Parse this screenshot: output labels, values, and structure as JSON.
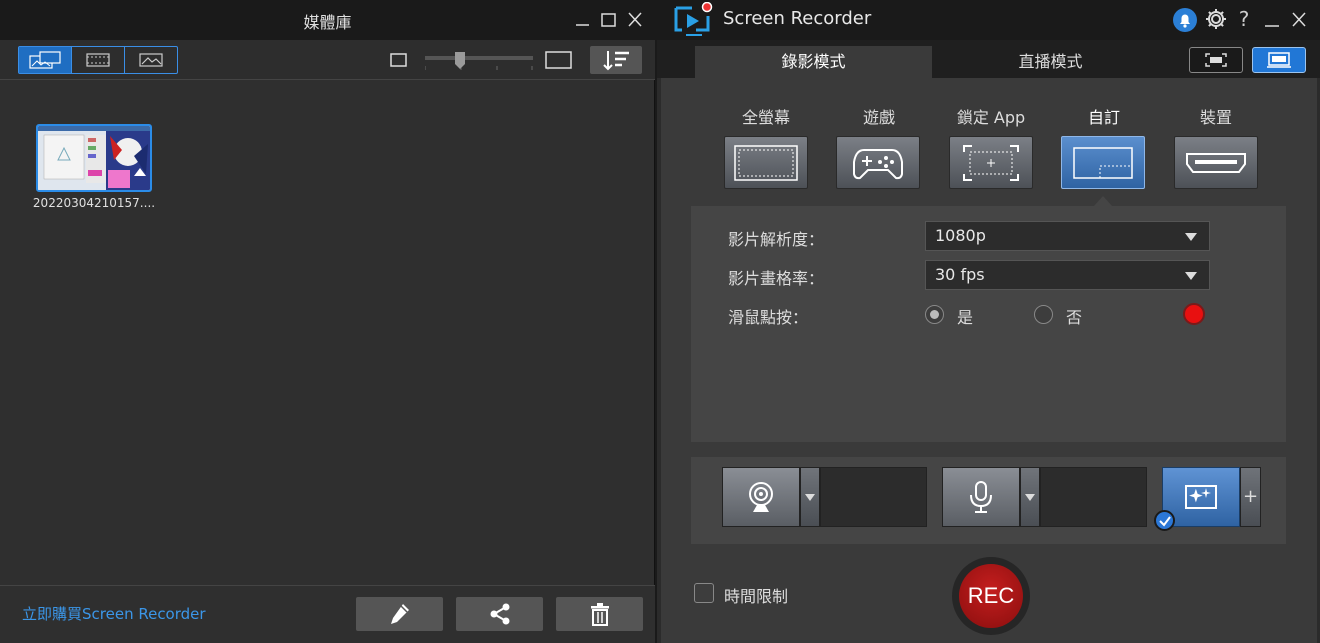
{
  "media_library": {
    "title": "媒體庫",
    "thumbnail_label": "20220304210157....",
    "buy_link": "立即購買Screen Recorder"
  },
  "recorder": {
    "title": "Screen Recorder",
    "tabs": [
      "錄影模式",
      "直播模式"
    ],
    "modes": [
      {
        "label": "全螢幕",
        "icon": "fullscreen-icon"
      },
      {
        "label": "遊戲",
        "icon": "gamepad-icon"
      },
      {
        "label": "鎖定 App",
        "icon": "lock-app-icon"
      },
      {
        "label": "自訂",
        "icon": "custom-region-icon",
        "selected": true
      },
      {
        "label": "裝置",
        "icon": "hdmi-icon"
      }
    ],
    "settings": {
      "resolution_label": "影片解析度：",
      "resolution_value": "1080p",
      "framerate_label": "影片畫格率：",
      "framerate_value": "30 fps",
      "mouse_label": "滑鼠點按：",
      "mouse_yes": "是",
      "mouse_no": "否"
    },
    "time_limit_label": "時間限制",
    "rec_label": "REC"
  },
  "colors": {
    "accent": "#2b8ce8",
    "rec": "#c41e1e",
    "mouse_click_color": "#e81010"
  }
}
